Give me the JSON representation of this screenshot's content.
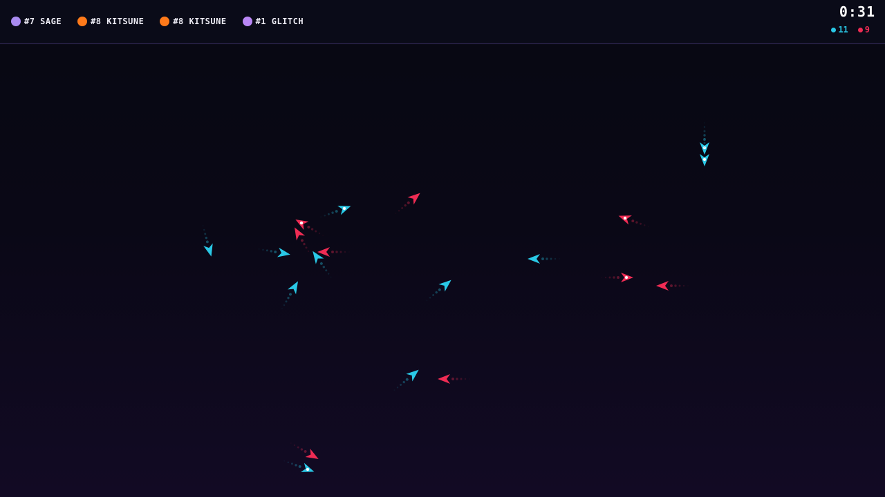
{
  "hud": {
    "players": [
      {
        "label": "#7 SAGE",
        "color": "#a98bf0"
      },
      {
        "label": "#8 KITSUNE",
        "color": "#ff7a1a"
      },
      {
        "label": "#8 KITSUNE",
        "color": "#ff7a1a"
      },
      {
        "label": "#1 GLITCH",
        "color": "#b987f5"
      }
    ],
    "timer": "0:31",
    "score_cyan": "11",
    "score_red": "9",
    "cyan_color": "#2ac8e6",
    "red_color": "#ef2c54"
  }
}
